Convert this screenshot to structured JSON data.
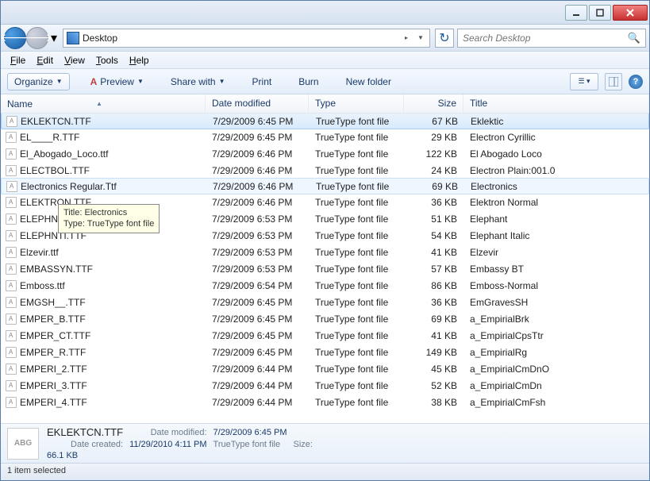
{
  "location": {
    "label": "Desktop",
    "chevron": "▸"
  },
  "search": {
    "placeholder": "Search Desktop"
  },
  "menus": {
    "file": "File",
    "edit": "Edit",
    "view": "View",
    "tools": "Tools",
    "help": "Help"
  },
  "toolbar": {
    "organize": "Organize",
    "preview": "Preview",
    "share": "Share with",
    "print": "Print",
    "burn": "Burn",
    "newfolder": "New folder"
  },
  "columns": {
    "name": "Name",
    "date": "Date modified",
    "type": "Type",
    "size": "Size",
    "title": "Title"
  },
  "files": [
    {
      "name": "EKLEKTCN.TTF",
      "date": "7/29/2009 6:45 PM",
      "type": "TrueType font file",
      "size": "67 KB",
      "title": "Eklektic",
      "state": "selected"
    },
    {
      "name": "EL____R.TTF",
      "date": "7/29/2009 6:45 PM",
      "type": "TrueType font file",
      "size": "29 KB",
      "title": "Electron Cyrillic"
    },
    {
      "name": "El_Abogado_Loco.ttf",
      "date": "7/29/2009 6:46 PM",
      "type": "TrueType font file",
      "size": "122 KB",
      "title": "El Abogado Loco"
    },
    {
      "name": "ELECTBOL.TTF",
      "date": "7/29/2009 6:46 PM",
      "type": "TrueType font file",
      "size": "24 KB",
      "title": "Electron Plain:001.0"
    },
    {
      "name": "Electronics Regular.Ttf",
      "date": "7/29/2009 6:46 PM",
      "type": "TrueType font file",
      "size": "69 KB",
      "title": "Electronics",
      "state": "hover"
    },
    {
      "name": "ELEKTRON.TTF",
      "date": "7/29/2009 6:46 PM",
      "type": "TrueType font file",
      "size": "36 KB",
      "title": "Elektron Normal"
    },
    {
      "name": "ELEPHNT.TTF",
      "date": "7/29/2009 6:53 PM",
      "type": "TrueType font file",
      "size": "51 KB",
      "title": "Elephant"
    },
    {
      "name": "ELEPHNTI.TTF",
      "date": "7/29/2009 6:53 PM",
      "type": "TrueType font file",
      "size": "54 KB",
      "title": "Elephant Italic"
    },
    {
      "name": "Elzevir.ttf",
      "date": "7/29/2009 6:53 PM",
      "type": "TrueType font file",
      "size": "41 KB",
      "title": "Elzevir"
    },
    {
      "name": "EMBASSYN.TTF",
      "date": "7/29/2009 6:53 PM",
      "type": "TrueType font file",
      "size": "57 KB",
      "title": "Embassy BT"
    },
    {
      "name": "Emboss.ttf",
      "date": "7/29/2009 6:54 PM",
      "type": "TrueType font file",
      "size": "86 KB",
      "title": "Emboss-Normal"
    },
    {
      "name": "EMGSH__.TTF",
      "date": "7/29/2009 6:45 PM",
      "type": "TrueType font file",
      "size": "36 KB",
      "title": "EmGravesSH"
    },
    {
      "name": "EMPER_B.TTF",
      "date": "7/29/2009 6:45 PM",
      "type": "TrueType font file",
      "size": "69 KB",
      "title": "a_EmpirialBrk"
    },
    {
      "name": "EMPER_CT.TTF",
      "date": "7/29/2009 6:45 PM",
      "type": "TrueType font file",
      "size": "41 KB",
      "title": "a_EmpirialCpsTtr"
    },
    {
      "name": "EMPER_R.TTF",
      "date": "7/29/2009 6:45 PM",
      "type": "TrueType font file",
      "size": "149 KB",
      "title": "a_EmpirialRg"
    },
    {
      "name": "EMPERI_2.TTF",
      "date": "7/29/2009 6:44 PM",
      "type": "TrueType font file",
      "size": "45 KB",
      "title": "a_EmpirialCmDnO"
    },
    {
      "name": "EMPERI_3.TTF",
      "date": "7/29/2009 6:44 PM",
      "type": "TrueType font file",
      "size": "52 KB",
      "title": "a_EmpirialCmDn"
    },
    {
      "name": "EMPERI_4.TTF",
      "date": "7/29/2009 6:44 PM",
      "type": "TrueType font file",
      "size": "38 KB",
      "title": "a_EmpirialCmFsh"
    }
  ],
  "tooltip": {
    "line1": "Title: Electronics",
    "line2": "Type: TrueType font file"
  },
  "details": {
    "icon_text": "ABG",
    "name": "EKLEKTCN.TTF",
    "type": "TrueType font file",
    "label_modified": "Date modified:",
    "modified": "7/29/2009 6:45 PM",
    "label_size": "Size:",
    "size": "66.1 KB",
    "label_created": "Date created:",
    "created": "11/29/2010 4:11 PM"
  },
  "status": "1 item selected"
}
